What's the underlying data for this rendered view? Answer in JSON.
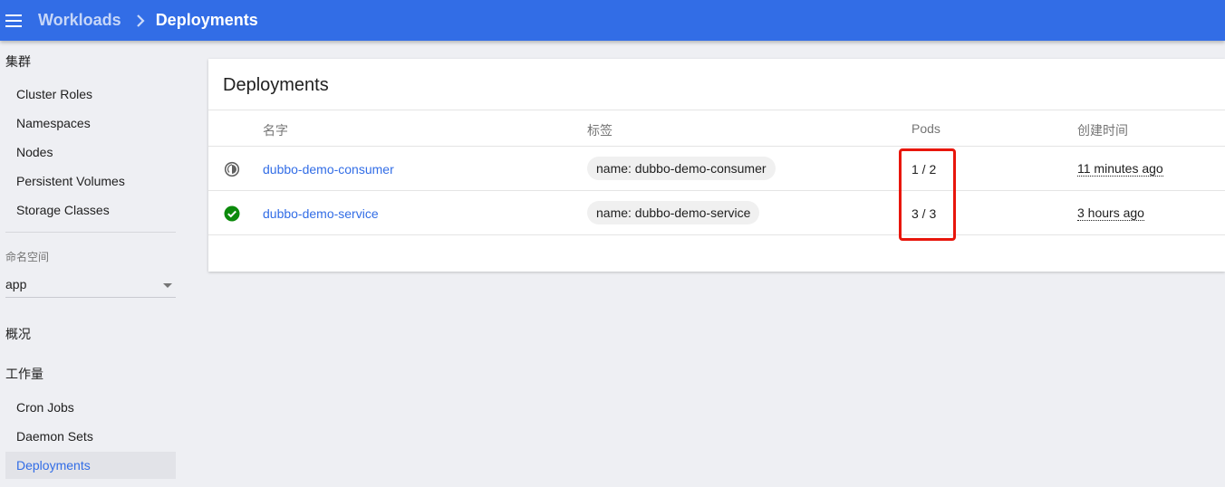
{
  "header": {
    "breadcrumb_parent": "Workloads",
    "breadcrumb_current": "Deployments",
    "bar_color": "#326de6"
  },
  "sidebar": {
    "cluster_title": "集群",
    "cluster_items": [
      "Cluster Roles",
      "Namespaces",
      "Nodes",
      "Persistent Volumes",
      "Storage Classes"
    ],
    "namespace_label": "命名空间",
    "namespace_value": "app",
    "overview": "概况",
    "workloads_title": "工作量",
    "workload_items": [
      "Cron Jobs",
      "Daemon Sets",
      "Deployments"
    ],
    "active_item": "Deployments"
  },
  "card": {
    "title": "Deployments",
    "columns": {
      "name": "名字",
      "labels": "标签",
      "pods": "Pods",
      "created": "创建时间"
    },
    "rows": [
      {
        "status": "pending-icon",
        "name": "dubbo-demo-consumer",
        "label": "name: dubbo-demo-consumer",
        "pods": "1 / 2",
        "age": "11 minutes ago"
      },
      {
        "status": "check-circle-icon",
        "name": "dubbo-demo-service",
        "label": "name: dubbo-demo-service",
        "pods": "3 / 3",
        "age": "3 hours ago"
      }
    ]
  },
  "annotation": {
    "highlight_color": "#e8160c"
  }
}
